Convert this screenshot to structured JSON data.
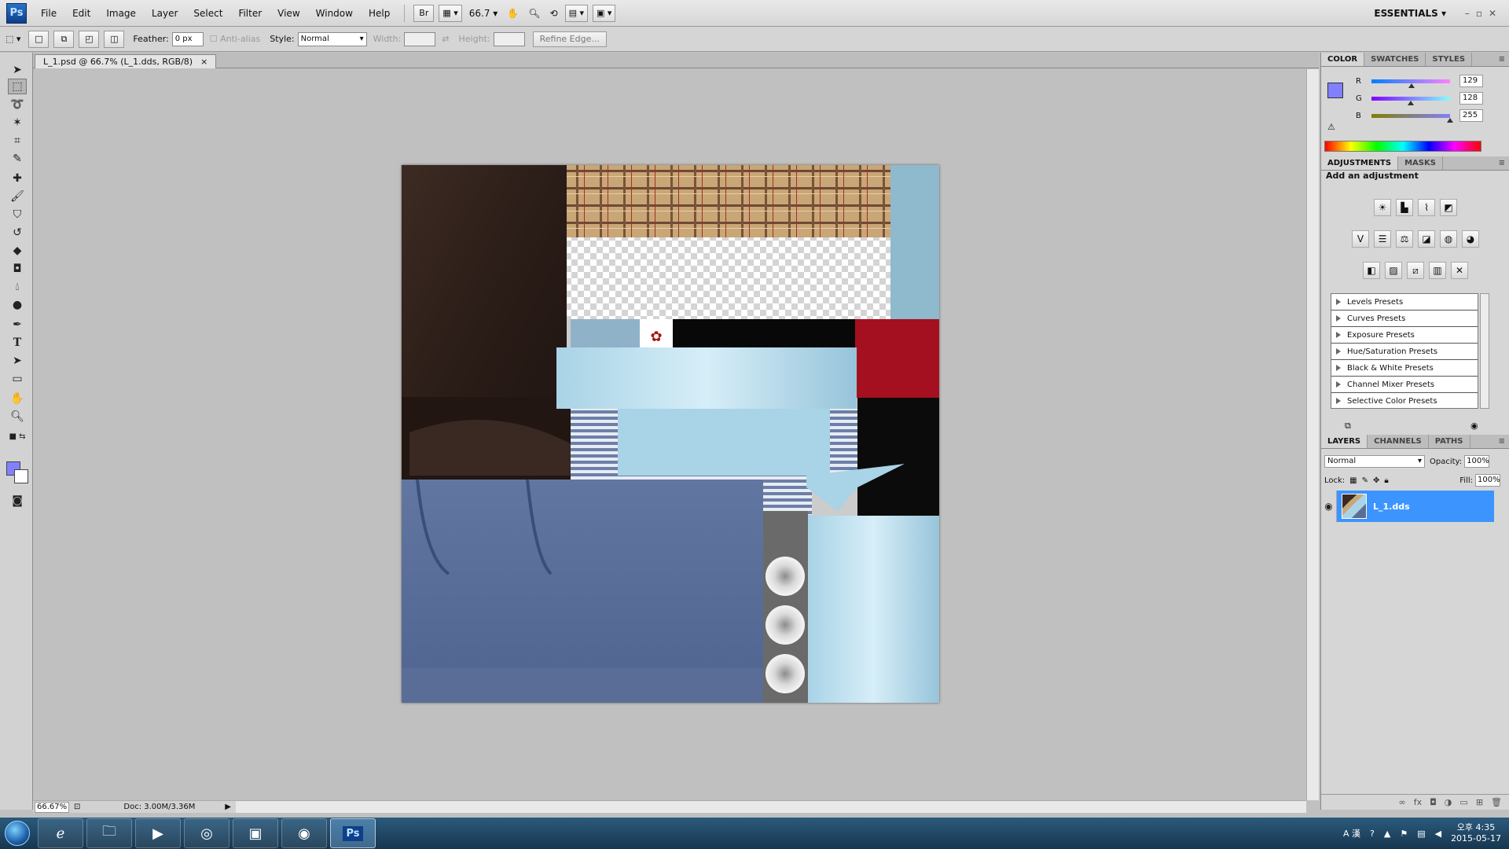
{
  "app": {
    "logo": "Ps",
    "menu": [
      "File",
      "Edit",
      "Image",
      "Layer",
      "Select",
      "Filter",
      "View",
      "Window",
      "Help"
    ],
    "bridge_button": "Br",
    "zoom_value": "66.7",
    "workspace": "ESSENTIALS",
    "window_controls": "–▫✕"
  },
  "options": {
    "feather_label": "Feather:",
    "feather_value": "0 px",
    "antialias_label": "Anti-alias",
    "style_label": "Style:",
    "style_value": "Normal",
    "width_label": "Width:",
    "height_label": "Height:",
    "refine_edge": "Refine Edge..."
  },
  "document": {
    "tab_title": "L_1.psd @ 66.7% (L_1.dds, RGB/8)",
    "tab_close": "×",
    "zoom_status": "66.67%",
    "doc_size": "Doc: 3.00M/3.36M"
  },
  "colors": {
    "foreground": "#8180ff",
    "background": "#ffffff",
    "layer_selected": "#3c95ff"
  },
  "color_panel": {
    "tabs": [
      "COLOR",
      "SWATCHES",
      "STYLES"
    ],
    "channels": [
      {
        "label": "R",
        "value": "129",
        "level": 0.506
      },
      {
        "label": "G",
        "value": "128",
        "level": 0.502
      },
      {
        "label": "B",
        "value": "255",
        "level": 1.0
      }
    ]
  },
  "adjustments_panel": {
    "tabs": [
      "ADJUSTMENTS",
      "MASKS"
    ],
    "title": "Add an adjustment",
    "presets": [
      "Levels Presets",
      "Curves Presets",
      "Exposure Presets",
      "Hue/Saturation Presets",
      "Black & White Presets",
      "Channel Mixer Presets",
      "Selective Color Presets"
    ]
  },
  "layers_panel": {
    "tabs": [
      "LAYERS",
      "CHANNELS",
      "PATHS"
    ],
    "blend_mode": "Normal",
    "opacity_label": "Opacity:",
    "opacity_value": "100%",
    "lock_label": "Lock:",
    "fill_label": "Fill:",
    "fill_value": "100%",
    "layer_name": "L_1.dds"
  },
  "taskbar": {
    "time": "오후 4:35",
    "date": "2015-05-17",
    "ime": "A 漢"
  }
}
